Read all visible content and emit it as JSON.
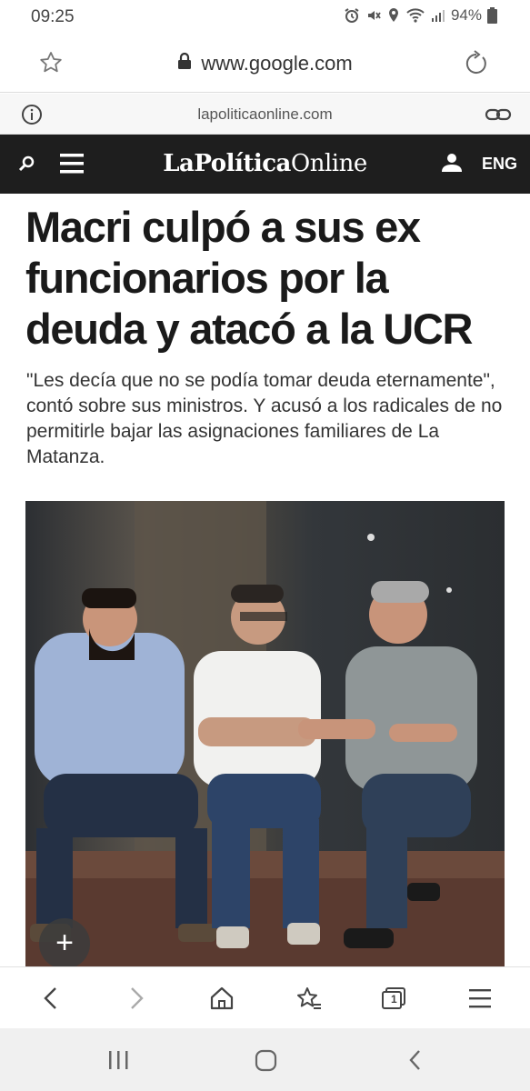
{
  "status_bar": {
    "time": "09:25",
    "battery": "94%",
    "icons": [
      "alarm-icon",
      "mute-icon",
      "location-icon",
      "wifi-icon",
      "signal-icon",
      "battery-icon"
    ]
  },
  "url_bar": {
    "url": "www.google.com",
    "icons": [
      "star-icon",
      "lock-icon",
      "reload-icon"
    ]
  },
  "site_info": {
    "domain": "lapoliticaonline.com",
    "icons": [
      "info-icon",
      "link-icon"
    ]
  },
  "site_header": {
    "logo_bold": "LaPolítica",
    "logo_regular": "Online",
    "lang": "ENG",
    "icons": [
      "search-icon",
      "menu-icon",
      "user-icon"
    ]
  },
  "article": {
    "headline_lines": [
      "Macri culpó a sus ex",
      "funcionarios por la",
      "deuda y atacó a la UCR"
    ],
    "subhead": "\"Les decía que no se podía tomar deuda eternamente\", contó sobre sus ministros. Y acusó a los radicales de no permitirle bajar las asignaciones familiares de La Matanza.",
    "fab_label": "+"
  },
  "browser_toolbar": {
    "icons": [
      "back-icon",
      "forward-icon",
      "home-icon",
      "bookmarks-icon",
      "tabs-icon",
      "menu-icon"
    ],
    "tab_count": "1"
  },
  "nav_bar": {
    "icons": [
      "recent-apps-icon",
      "home-icon",
      "back-icon"
    ]
  },
  "colors": {
    "header_bg": "#1e1e1e",
    "headline": "#1a1a1a"
  }
}
